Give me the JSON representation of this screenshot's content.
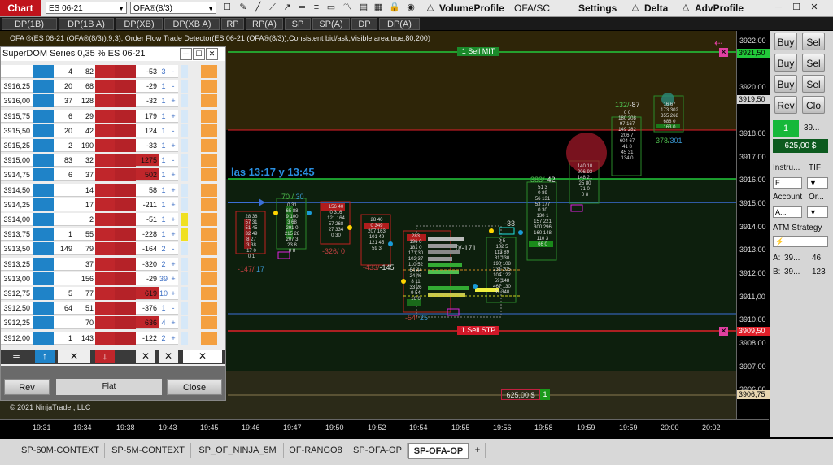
{
  "toolbar": {
    "chart_tab": "Chart",
    "instrument": "ES 06-21",
    "template": "OFA®(8/3)",
    "volume_profile": "VolumeProfile",
    "ofa_sc": "OFA/SC",
    "settings": "Settings",
    "delta": "Delta",
    "adv_profile": "AdvProfile"
  },
  "indicator_buttons": [
    "DP(1B)",
    "DP(1B A)",
    "DP(XB)",
    "DP(XB A)",
    "RP",
    "RP(A)",
    "SP",
    "SP(A)",
    "DP",
    "DP(A)"
  ],
  "indicator_line": "OFA ®(ES 06-21 (OFA®(8/3)),9,3), Order Flow Trade Detector(ES 06-21 (OFA®(8/3)),Consistent bid/ask,Visible area,true,80,200)",
  "annotation": "las 13:17 y  13:45",
  "copyright": "© 2021 NinjaTrader, LLC",
  "orders": {
    "sell_mit": "1  Sell MIT",
    "sell_stp": "1  Sell STP",
    "pnl": "625,00 $",
    "pnl_qty": "1"
  },
  "price_axis": {
    "labels": [
      "3922,00",
      "3921,00",
      "3920,00",
      "3919,00",
      "3918,00",
      "3917,00",
      "3916,00",
      "3915,00",
      "3914,00",
      "3913,00",
      "3912,00",
      "3911,00",
      "3910,00",
      "3909,00",
      "3908,00",
      "3907,00",
      "3906,00"
    ],
    "marker_sell_mit": "3921,50",
    "marker_current": "3919,50",
    "marker_sell_stp": "3909,50",
    "marker_avg": "3906,75"
  },
  "time_axis": [
    "19:31",
    "19:34",
    "19:38",
    "19:43",
    "19:45",
    "19:46",
    "19:47",
    "19:50",
    "19:52",
    "19:54",
    "19:55",
    "19:56",
    "19:58",
    "19:59",
    "19:59",
    "20:00",
    "20:02"
  ],
  "superdom": {
    "title": "SuperDOM Series 0,35 % ES 06-21",
    "rows": [
      {
        "price": "",
        "bv": "4",
        "av": "82",
        "vol": "-53",
        "n": "3",
        "s": "-"
      },
      {
        "price": "3916,25",
        "bv": "20",
        "av": "68",
        "vol": "-29",
        "n": "1",
        "s": "-"
      },
      {
        "price": "3916,00",
        "bv": "37",
        "av": "128",
        "vol": "-32",
        "n": "1",
        "s": "+"
      },
      {
        "price": "3915,75",
        "bv": "6",
        "av": "29",
        "vol": "179",
        "n": "1",
        "s": "+"
      },
      {
        "price": "3915,50",
        "bv": "20",
        "av": "42",
        "vol": "124",
        "n": "1",
        "s": "-"
      },
      {
        "price": "3915,25",
        "bv": "2",
        "av": "190",
        "vol": "-33",
        "n": "1",
        "s": "+"
      },
      {
        "price": "3915,00",
        "bv": "83",
        "av": "32",
        "vol": "1275",
        "n": "1",
        "s": "-"
      },
      {
        "price": "3914,75",
        "bv": "6",
        "av": "37",
        "vol": "502",
        "n": "1",
        "s": "+"
      },
      {
        "price": "3914,50",
        "bv": "",
        "av": "14",
        "vol": "58",
        "n": "1",
        "s": "+"
      },
      {
        "price": "3914,25",
        "bv": "",
        "av": "17",
        "vol": "-211",
        "n": "1",
        "s": "+"
      },
      {
        "price": "3914,00",
        "bv": "",
        "av": "2",
        "vol": "-51",
        "n": "1",
        "s": "+"
      },
      {
        "price": "3913,75",
        "bv": "1",
        "av": "55",
        "vol": "-228",
        "n": "1",
        "s": "+"
      },
      {
        "price": "3913,50",
        "bv": "149",
        "av": "79",
        "vol": "-164",
        "n": "2",
        "s": "-"
      },
      {
        "price": "3913,25",
        "bv": "",
        "av": "37",
        "vol": "-320",
        "n": "2",
        "s": "+"
      },
      {
        "price": "3913,00",
        "bv": "",
        "av": "156",
        "vol": "-29",
        "n": "39",
        "s": "+"
      },
      {
        "price": "3912,75",
        "bv": "5",
        "av": "77",
        "vol": "619",
        "n": "10",
        "s": "+"
      },
      {
        "price": "3912,50",
        "bv": "64",
        "av": "51",
        "vol": "-376",
        "n": "1",
        "s": "-"
      },
      {
        "price": "3912,25",
        "bv": "",
        "av": "70",
        "vol": "636",
        "n": "4",
        "s": "+"
      },
      {
        "price": "3912,00",
        "bv": "1",
        "av": "143",
        "vol": "-122",
        "n": "2",
        "s": "+"
      }
    ],
    "rev": "Rev",
    "flat": "Flat",
    "close": "Close"
  },
  "right_panel": {
    "buy": "Buy",
    "sell": "Sel",
    "rev": "Rev",
    "close": "Clo",
    "qty": "1",
    "price": "39...",
    "pnl": "625,00 $",
    "instrument_label": "Instru...",
    "tif_label": "TIF",
    "instrument_value": "E...",
    "account_label": "Account",
    "order_label": "Or...",
    "account_value": "A...",
    "atm_label": "ATM Strategy",
    "a_label": "A:",
    "a_price": "39...",
    "a_qty": "46",
    "b_label": "B:",
    "b_price": "39...",
    "b_qty": "123"
  },
  "tabs": [
    "SP-60M-CONTEXT",
    "SP-5M-CONTEXT",
    "SP_OF_NINJA_5M",
    "OF-RANGO8",
    "SP-OFA-OP",
    "SP-OFA-OP",
    "+"
  ],
  "colors": {
    "chart_tab": "#c0141c",
    "bid": "#1f83c8",
    "ask": "#c0262b",
    "sell_mit_line": "#22c93a",
    "sell_stp_line": "#e0202a",
    "blue_line": "#3b6fd6"
  }
}
